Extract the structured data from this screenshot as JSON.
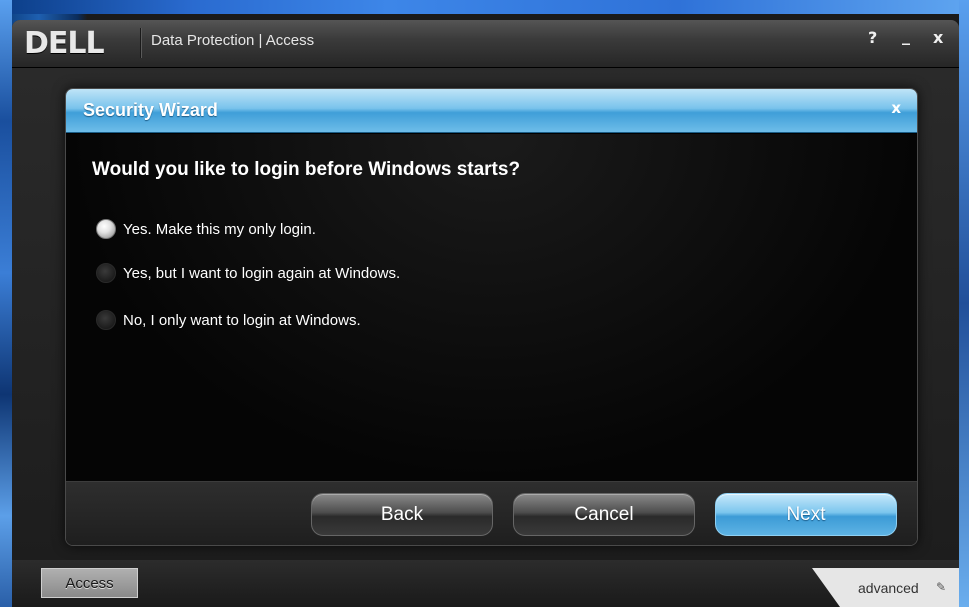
{
  "app": {
    "logo": "DELL",
    "title": "Data Protection | Access",
    "help": "?",
    "minimize": "_",
    "close": "x"
  },
  "dialog": {
    "title": "Security Wizard",
    "close": "x",
    "question": "Would you like to login before Windows starts?",
    "options": [
      {
        "label": "Yes.  Make this my only login.",
        "selected": true
      },
      {
        "label": "Yes, but I want to login again at Windows.",
        "selected": false
      },
      {
        "label": "No, I only want to login at Windows.",
        "selected": false
      }
    ],
    "buttons": {
      "back": "Back",
      "cancel": "Cancel",
      "next": "Next"
    }
  },
  "bottom_bar": {
    "access_tab": "Access",
    "advanced_tab": "advanced",
    "advanced_icon": "settings-icon"
  },
  "colors": {
    "dialog_header_accent": "#4aa6de",
    "primary_button": "#5eb3e4",
    "background": "#000000"
  }
}
